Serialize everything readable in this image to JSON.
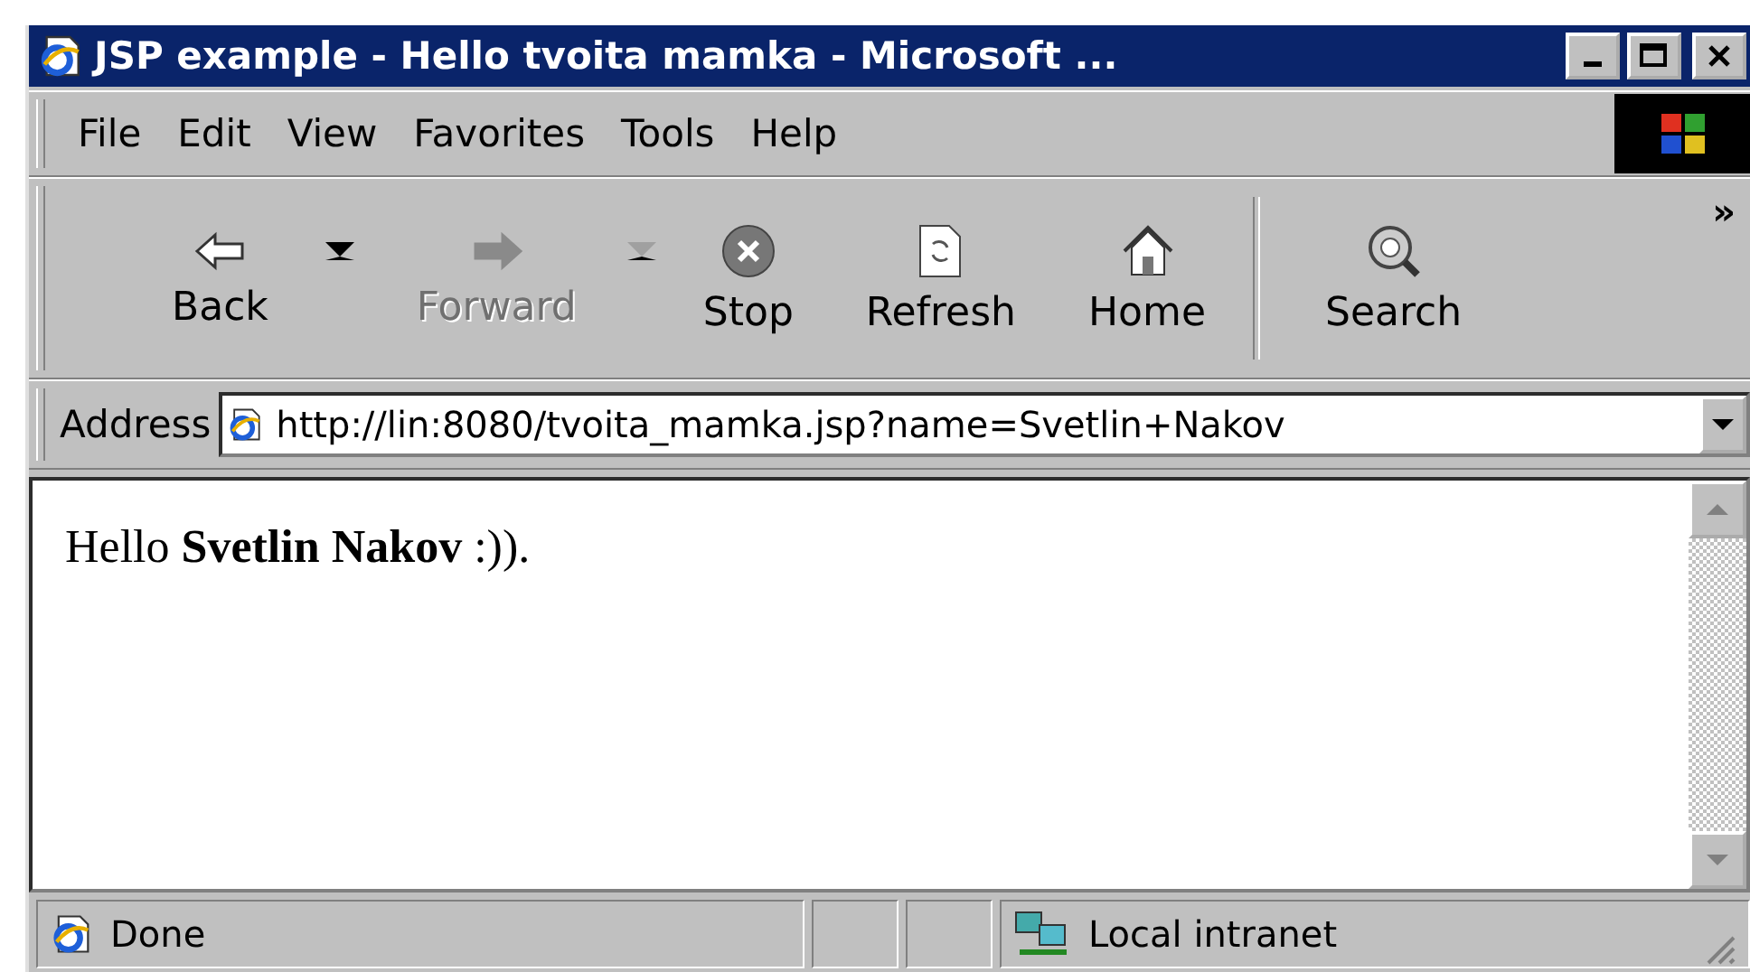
{
  "window": {
    "title": "JSP example - Hello tvoita mamka - Microsoft ..."
  },
  "menu": [
    {
      "label": "File"
    },
    {
      "label": "Edit"
    },
    {
      "label": "View"
    },
    {
      "label": "Favorites"
    },
    {
      "label": "Tools"
    },
    {
      "label": "Help"
    }
  ],
  "toolbar": [
    {
      "kind": "back",
      "label": "Back",
      "disabled": false,
      "dropdown": true
    },
    {
      "kind": "forward",
      "label": "Forward",
      "disabled": true,
      "dropdown": true
    },
    {
      "kind": "stop",
      "label": "Stop",
      "disabled": false,
      "dropdown": false
    },
    {
      "kind": "refresh",
      "label": "Refresh",
      "disabled": false,
      "dropdown": false
    },
    {
      "kind": "home",
      "label": "Home",
      "disabled": false,
      "dropdown": false
    },
    {
      "kind": "separator"
    },
    {
      "kind": "search",
      "label": "Search",
      "disabled": false,
      "dropdown": false
    }
  ],
  "toolbar_overflow": "»",
  "address": {
    "label": "Address",
    "value": "http://lin:8080/tvoita_mamka.jsp?name=Svetlin+Nakov"
  },
  "page": {
    "text": "Hello **Svetlin Nakov** :))."
  },
  "status_bar": {
    "text": "Done",
    "zone": "Local intranet"
  }
}
